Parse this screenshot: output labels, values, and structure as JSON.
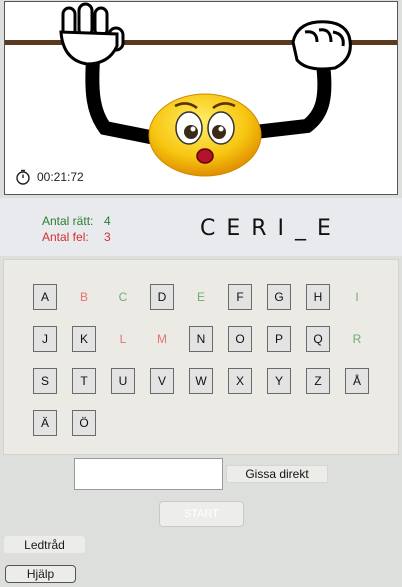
{
  "timer": {
    "value": "00:21:72",
    "icon": "stopwatch-icon"
  },
  "score": {
    "correct_label": "Antal rätt:",
    "correct_value": "4",
    "wrong_label": "Antal fel:",
    "wrong_value": "3",
    "colors": {
      "correct": "#2e7d32",
      "wrong": "#d32f2f"
    }
  },
  "word": {
    "display": "CERI_E"
  },
  "keyboard": {
    "keys": [
      {
        "letter": "A",
        "state": "available"
      },
      {
        "letter": "B",
        "state": "miss"
      },
      {
        "letter": "C",
        "state": "hit"
      },
      {
        "letter": "D",
        "state": "available"
      },
      {
        "letter": "E",
        "state": "hit"
      },
      {
        "letter": "F",
        "state": "available"
      },
      {
        "letter": "G",
        "state": "available"
      },
      {
        "letter": "H",
        "state": "available"
      },
      {
        "letter": "I",
        "state": "hit"
      },
      {
        "letter": "J",
        "state": "available"
      },
      {
        "letter": "K",
        "state": "available"
      },
      {
        "letter": "L",
        "state": "miss"
      },
      {
        "letter": "M",
        "state": "miss"
      },
      {
        "letter": "N",
        "state": "available"
      },
      {
        "letter": "O",
        "state": "available"
      },
      {
        "letter": "P",
        "state": "available"
      },
      {
        "letter": "Q",
        "state": "available"
      },
      {
        "letter": "R",
        "state": "hit"
      },
      {
        "letter": "S",
        "state": "available"
      },
      {
        "letter": "T",
        "state": "available"
      },
      {
        "letter": "U",
        "state": "available"
      },
      {
        "letter": "V",
        "state": "available"
      },
      {
        "letter": "W",
        "state": "available"
      },
      {
        "letter": "X",
        "state": "available"
      },
      {
        "letter": "Y",
        "state": "available"
      },
      {
        "letter": "Z",
        "state": "available"
      },
      {
        "letter": "Å",
        "state": "available"
      },
      {
        "letter": "Ä",
        "state": "available"
      },
      {
        "letter": "Ö",
        "state": "available"
      }
    ],
    "colors": {
      "hit": "#6fae73",
      "miss": "#e57373"
    }
  },
  "guess": {
    "input_value": "",
    "button_label": "Gissa direkt"
  },
  "buttons": {
    "start": "START",
    "hint": "Ledtråd",
    "help": "Hjälp"
  }
}
